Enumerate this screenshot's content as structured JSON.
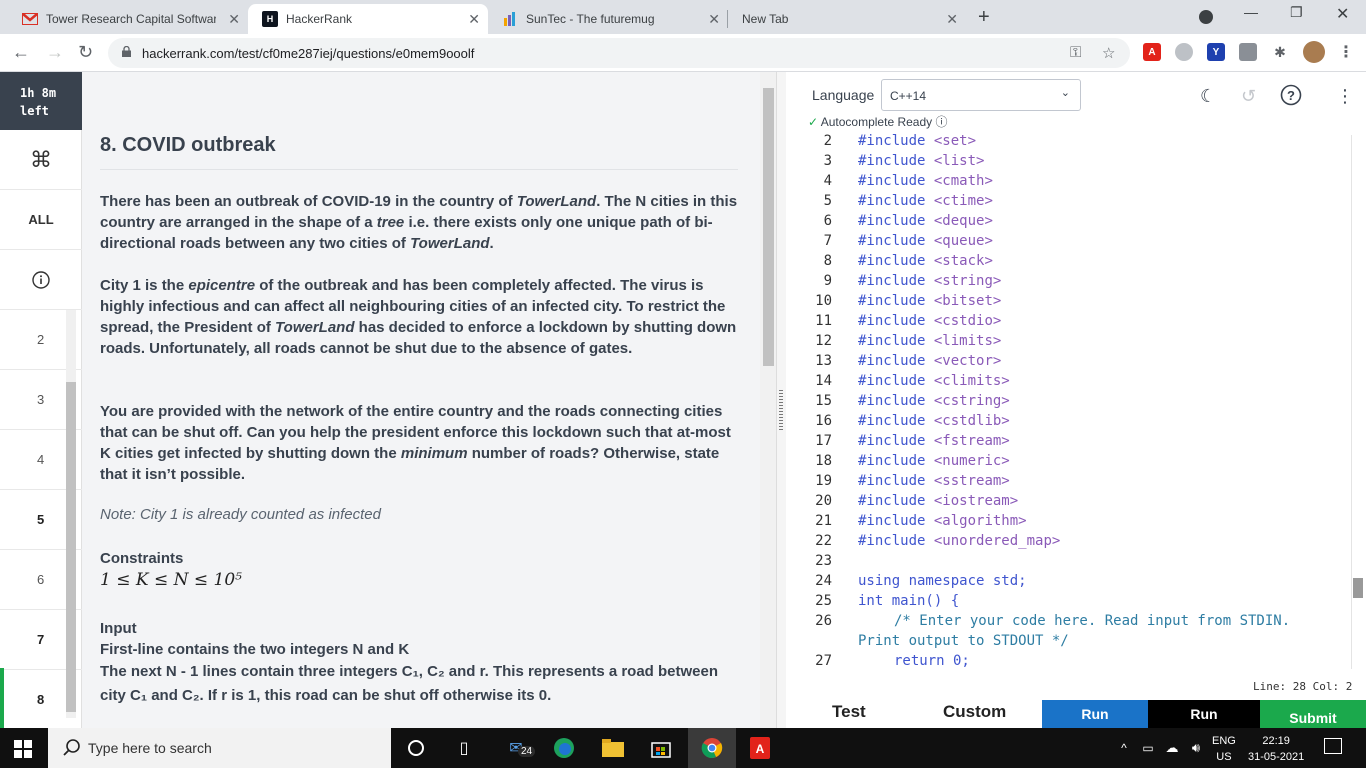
{
  "browser": {
    "tabs": [
      {
        "label": "Tower Research Capital Software",
        "icon": "gmail-icon"
      },
      {
        "label": "HackerRank",
        "icon": "hackerrank-icon"
      },
      {
        "label": "SunTec - The futuremug",
        "icon": "suntec-icon"
      },
      {
        "label": "New Tab",
        "icon": ""
      }
    ],
    "url": "hackerrank.com/test/cf0me287iej/questions/e0mem9ooolf"
  },
  "sidebar": {
    "timer_line1": "1h 8m",
    "timer_line2": "left",
    "all_label": "ALL",
    "questions": [
      "2",
      "3",
      "4",
      "5",
      "6",
      "7",
      "8"
    ]
  },
  "problem": {
    "title": "8. COVID outbreak",
    "p1_a": "There has been an outbreak of COVID-19 in the country of ",
    "p1_b": "TowerLand",
    "p1_c": ". The N cities in this country are arranged in the shape of a ",
    "p1_d": "tree",
    "p1_e": " i.e. there exists only one unique path of bi-directional roads between any two cities of ",
    "p1_f": "TowerLand",
    "p1_g": ".",
    "p2_a": "City 1 is the ",
    "p2_b": "epicentre",
    "p2_c": " of the outbreak and has been completely affected. The virus is highly infectious and can affect all neighbouring cities of an infected city. To restrict the spread, the President of ",
    "p2_d": "TowerLand",
    "p2_e": " has decided to enforce a lockdown by shutting down roads. Unfortunately, all roads cannot be shut due to the absence of gates.",
    "p3_a": "You are provided with the network of the entire country and the roads connecting cities that can be shut off. Can you help the president enforce this lockdown such that at-most K cities get infected by shutting down the ",
    "p3_b": "minimum",
    "p3_c": " number of roads? Otherwise, state that it isn’t possible.",
    "note": "Note: City 1 is already counted as infected",
    "constraints_heading": "Constraints",
    "constraint_math": "1 ≤ K ≤ N ≤ 10⁵",
    "input_heading": "Input",
    "input_line1": "First-line contains the two integers N and K",
    "input_line2": "The next N - 1 lines contain three integers C₁, C₂ and r. This represents a road between city C₁ and C₂. If r is 1, this road can be shut off otherwise its 0."
  },
  "editor": {
    "language_label": "Language",
    "language_value": "C++14",
    "autocomplete": "Autocomplete Ready",
    "status": "Line: 28 Col: 2",
    "lines": [
      {
        "n": "2",
        "hdr": "<set>"
      },
      {
        "n": "3",
        "hdr": "<list>"
      },
      {
        "n": "4",
        "hdr": "<cmath>"
      },
      {
        "n": "5",
        "hdr": "<ctime>"
      },
      {
        "n": "6",
        "hdr": "<deque>"
      },
      {
        "n": "7",
        "hdr": "<queue>"
      },
      {
        "n": "8",
        "hdr": "<stack>"
      },
      {
        "n": "9",
        "hdr": "<string>"
      },
      {
        "n": "10",
        "hdr": "<bitset>"
      },
      {
        "n": "11",
        "hdr": "<cstdio>"
      },
      {
        "n": "12",
        "hdr": "<limits>"
      },
      {
        "n": "13",
        "hdr": "<vector>"
      },
      {
        "n": "14",
        "hdr": "<climits>"
      },
      {
        "n": "15",
        "hdr": "<cstring>"
      },
      {
        "n": "16",
        "hdr": "<cstdlib>"
      },
      {
        "n": "17",
        "hdr": "<fstream>"
      },
      {
        "n": "18",
        "hdr": "<numeric>"
      },
      {
        "n": "19",
        "hdr": "<sstream>"
      },
      {
        "n": "20",
        "hdr": "<iostream>"
      },
      {
        "n": "21",
        "hdr": "<algorithm>"
      },
      {
        "n": "22",
        "hdr": "<unordered_map>"
      }
    ],
    "include_kw": "#include",
    "line23": "23",
    "line24": "24",
    "using_stmt": "using namespace std;",
    "line25": "25",
    "main_sig": "int main() {",
    "line26": "26",
    "comment1": "/* Enter your code here. Read input from STDIN.",
    "comment2": "Print output to STDOUT */",
    "line27": "27",
    "return_stmt": "return 0;"
  },
  "bottom": {
    "test_tab": "Test",
    "custom_tab": "Custom",
    "run1": "Run",
    "run2": "Run",
    "submit": "Submit"
  },
  "taskbar": {
    "search_placeholder": "Type here to search",
    "mail_badge": "24",
    "lang_line1": "ENG",
    "lang_line2": "US",
    "time": "22:19",
    "date": "31-05-2021"
  },
  "colors": {
    "timer_bg": "#39424e",
    "run_blue": "#1a73c8",
    "submit_green": "#1ba94c",
    "active_green": "#1ba94c"
  }
}
